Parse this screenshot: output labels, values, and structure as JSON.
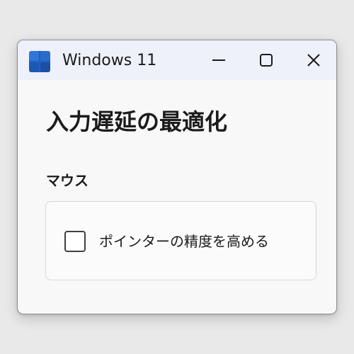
{
  "window": {
    "title": "Windows 11",
    "app_icon": "windows-logo-icon",
    "controls": {
      "minimize_icon": "minimize-icon",
      "maximize_icon": "maximize-icon",
      "close_icon": "close-icon"
    }
  },
  "main": {
    "title": "入力遅延の最適化",
    "section_label": "マウス",
    "option": {
      "label": "ポインターの精度を高める",
      "checked": false
    }
  },
  "colors": {
    "titlebar_bg": "#eef1fa",
    "window_bg": "#f8f8f8",
    "logo_blue": "#1f5fbf",
    "text": "#1b1b1b"
  }
}
